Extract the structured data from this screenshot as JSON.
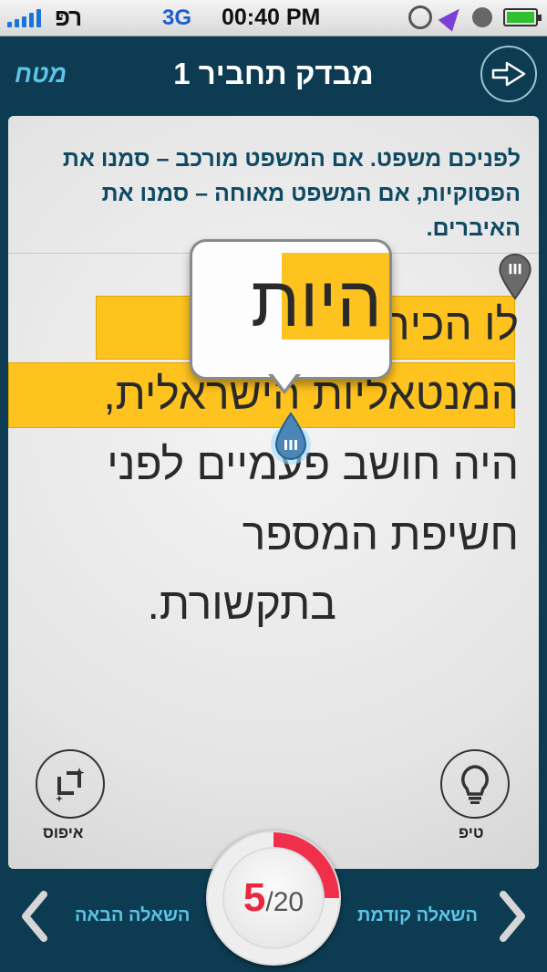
{
  "status_bar": {
    "carrier": "רפּ",
    "network": "3G",
    "time": "00:40 PM"
  },
  "header": {
    "logo": "מטח",
    "title": "מבדק תחביר 1",
    "next_icon": "arrow-right-circle-icon"
  },
  "question": {
    "instructions": "לפניכם משפט. אם המשפט מורכב – סמנו את הפסוקיות, אם המשפט מאוחה – סמנו את האיברים.",
    "sentence_lines": [
      "לו הכירו את",
      "המנטאליות הישראלית,",
      "היה חושב פעמיים לפני",
      "חשיפת המספר",
      "בתקשורת."
    ],
    "magnifier_text": "היות",
    "highlight_color": "#ffc31f"
  },
  "tools": {
    "tip_label": "טיפ",
    "reset_label": "איפוס"
  },
  "footer": {
    "prev_label": "השאלה קודמת",
    "next_label": "השאלה הבאה",
    "progress_current": "5",
    "progress_total": "/20",
    "progress_fraction": 0.25,
    "progress_color": "#f0304a"
  }
}
